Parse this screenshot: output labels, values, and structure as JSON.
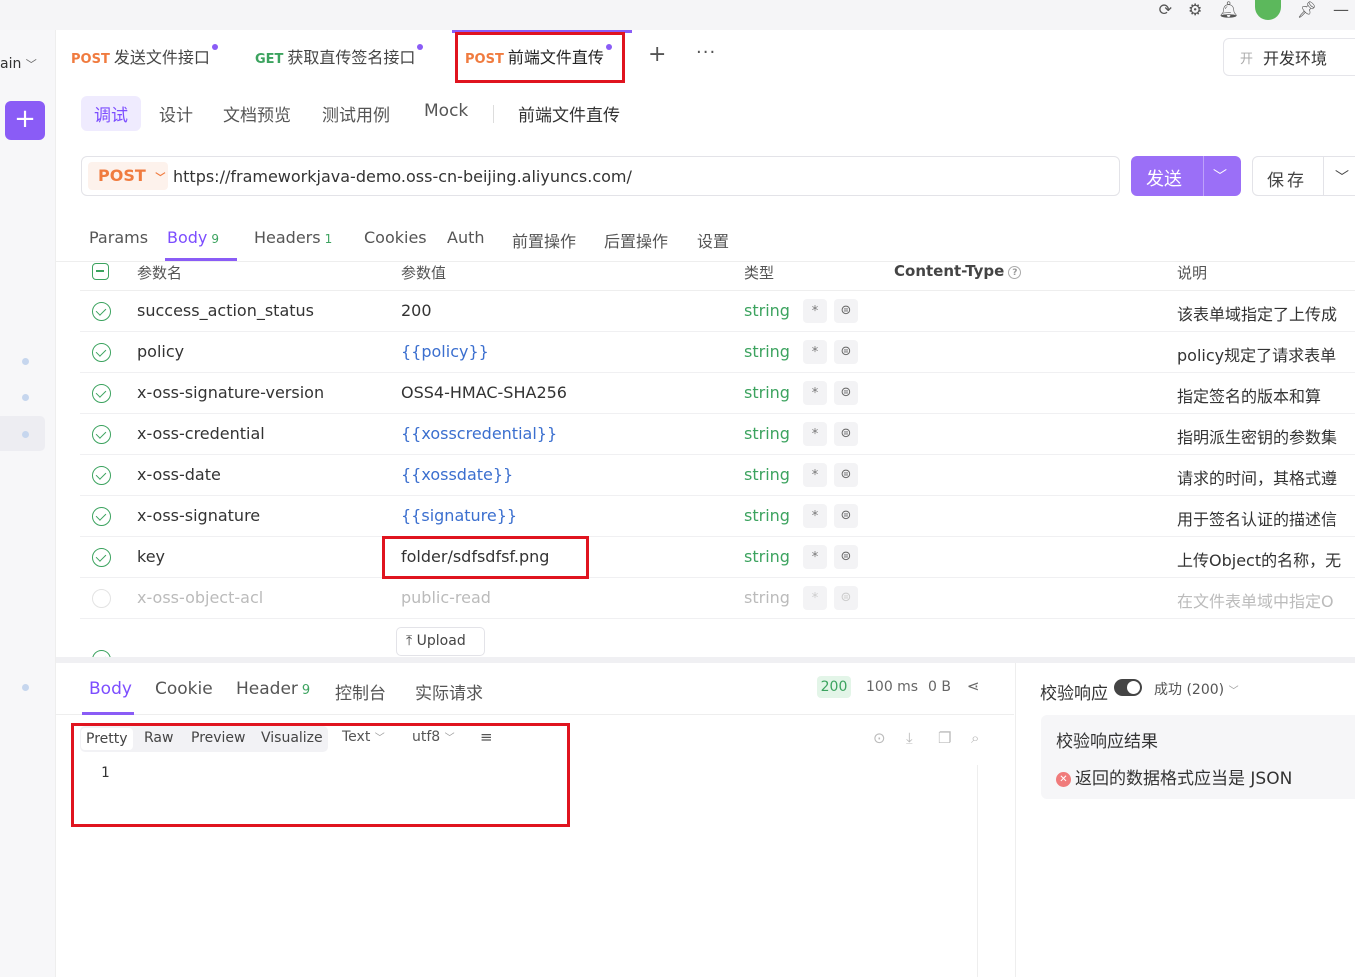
{
  "app": {
    "brand_partial": "ain",
    "top_icons": [
      "sync-icon",
      "gear-icon",
      "bell-icon",
      "avatar",
      "pin-icon",
      "minimize-icon"
    ]
  },
  "tabs": [
    {
      "method": "POST",
      "label": "发送文件接口",
      "modified": true
    },
    {
      "method": "GET",
      "label": "获取直传签名接口",
      "modified": true
    },
    {
      "method": "POST",
      "label": "前端文件直传",
      "modified": true,
      "active": true
    }
  ],
  "env": {
    "icon_char": "开",
    "label": "开发环境"
  },
  "subtabs": {
    "debug": "调试",
    "design": "设计",
    "docs": "文档预览",
    "testcases": "测试用例",
    "mock": "Mock",
    "api_name": "前端文件直传"
  },
  "request": {
    "method": "POST",
    "url": "https://frameworkjava-demo.oss-cn-beijing.aliyuncs.com/",
    "send_label": "发送",
    "save_label": "保存"
  },
  "param_tabs": {
    "params": "Params",
    "body": "Body",
    "body_count": "9",
    "headers": "Headers",
    "headers_count": "1",
    "cookies": "Cookies",
    "auth": "Auth",
    "pre": "前置操作",
    "post": "后置操作",
    "settings": "设置"
  },
  "table": {
    "headers": {
      "name": "参数名",
      "value": "参数值",
      "type": "类型",
      "content_type": "Content-Type",
      "desc": "说明"
    },
    "rows": [
      {
        "name": "success_action_status",
        "value": "200",
        "type": "string",
        "desc": "该表单域指定了上传成",
        "enabled": true,
        "var": false
      },
      {
        "name": "policy",
        "value": "{{policy}}",
        "type": "string",
        "desc": "policy规定了请求表单",
        "enabled": true,
        "var": true
      },
      {
        "name": "x-oss-signature-version",
        "value": "OSS4-HMAC-SHA256",
        "type": "string",
        "desc": "指定签名的版本和算",
        "enabled": true,
        "var": false
      },
      {
        "name": "x-oss-credential",
        "value": "{{xosscredential}}",
        "type": "string",
        "desc": "指明派生密钥的参数集",
        "enabled": true,
        "var": true
      },
      {
        "name": "x-oss-date",
        "value": "{{xossdate}}",
        "type": "string",
        "desc": "请求的时间，其格式遵",
        "enabled": true,
        "var": true
      },
      {
        "name": "x-oss-signature",
        "value": "{{signature}}",
        "type": "string",
        "desc": "用于签名认证的描述信",
        "enabled": true,
        "var": true
      },
      {
        "name": "key",
        "value": "folder/sdfsdfsf.png",
        "type": "string",
        "desc": "上传Object的名称，无",
        "enabled": true,
        "var": false
      },
      {
        "name": "x-oss-object-acl",
        "value": "public-read",
        "type": "string",
        "desc": "在文件表单域中指定O",
        "enabled": false,
        "var": false
      }
    ],
    "req_mark": "*",
    "upload_label": "Upload"
  },
  "response": {
    "tabs": {
      "body": "Body",
      "cookie": "Cookie",
      "header": "Header",
      "header_count": "9",
      "console": "控制台",
      "actual": "实际请求"
    },
    "status": "200",
    "time": "100 ms",
    "size": "0 B",
    "formats": {
      "pretty": "Pretty",
      "raw": "Raw",
      "preview": "Preview",
      "visualize": "Visualize"
    },
    "type_select": "Text",
    "encoding_select": "utf8",
    "line_number": "1"
  },
  "validation": {
    "title": "校验响应",
    "enabled": true,
    "select": "成功 (200)",
    "result_title": "校验响应结果",
    "error": "返回的数据格式应当是 JSON"
  },
  "colors": {
    "accent": "#8a5cf6",
    "post": "#f07b3f",
    "get": "#3ca35f",
    "highlight": "#e0141f",
    "variable": "#3b6fcf"
  }
}
